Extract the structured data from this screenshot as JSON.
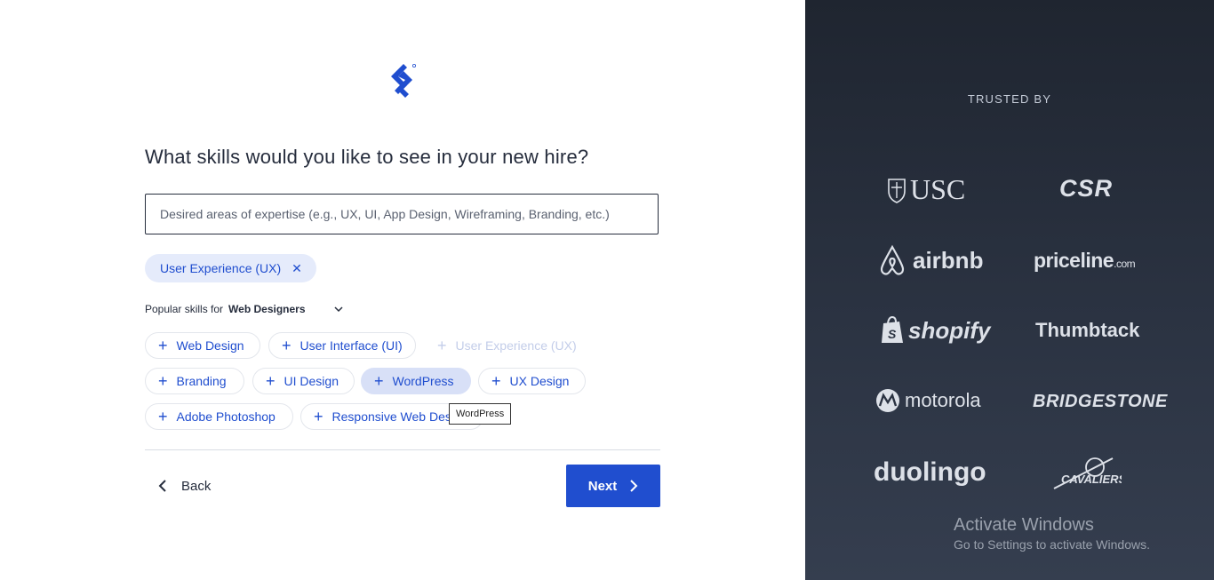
{
  "form": {
    "title": "What skills would you like to see in your new hire?",
    "search_placeholder": "Desired areas of expertise (e.g., UX, UI, App Design, Wireframing, Branding, etc.)",
    "search_value": "",
    "selected_skills": [
      {
        "label": "User Experience (UX)",
        "remove_icon": "close-icon"
      }
    ],
    "popular_prefix": "Popular skills for",
    "popular_role": "Web Designers",
    "skills": [
      {
        "label": "Web Design",
        "state": "available"
      },
      {
        "label": "User Interface (UI)",
        "state": "available"
      },
      {
        "label": "User Experience (UX)",
        "state": "selected-disabled"
      },
      {
        "label": "Branding",
        "state": "available"
      },
      {
        "label": "UI Design",
        "state": "available"
      },
      {
        "label": "WordPress",
        "state": "hovered"
      },
      {
        "label": "UX Design",
        "state": "available"
      },
      {
        "label": "Adobe Photoshop",
        "state": "available"
      },
      {
        "label": "Responsive Web Design",
        "state": "available"
      }
    ],
    "tooltip": "WordPress",
    "back_label": "Back",
    "next_label": "Next"
  },
  "sidebar": {
    "heading": "TRUSTED BY",
    "logos": [
      "USC",
      "CSR",
      "airbnb",
      "priceline.com",
      "shopify",
      "Thumbtack",
      "motorola",
      "BRIDGESTONE",
      "duolingo",
      "CAVALIERS"
    ]
  },
  "watermark": {
    "title": "Activate Windows",
    "subtitle": "Go to Settings to activate Windows."
  },
  "colors": {
    "accent": "#204ecf",
    "chip_bg": "#e5ebfb",
    "sidebar_bg_top": "#1f2530",
    "sidebar_bg_bottom": "#353e4f"
  }
}
